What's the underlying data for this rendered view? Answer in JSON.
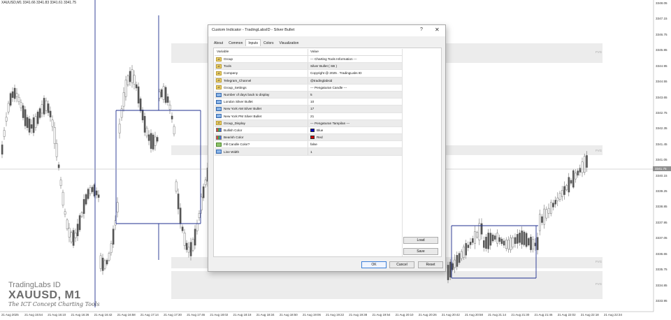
{
  "chart": {
    "header": "XAUUSD,M1  3341.66 3341.83 3341.61 3341.75",
    "price_tag": "3341.75",
    "y_axis": [
      "3348.05",
      "3347.15",
      "3346.75",
      "3345.85",
      "3344.95",
      "3344.55",
      "3343.65",
      "3342.75",
      "3342.35",
      "3341.45",
      "3341.05",
      "3340.15",
      "3339.25",
      "3338.85",
      "3337.95",
      "3337.05",
      "3336.65",
      "3335.75",
      "3334.85",
      "3333.95"
    ],
    "x_axis": [
      "21 Aug 2025",
      "21 Aug 15:54",
      "21 Aug 16:10",
      "21 Aug 16:26",
      "21 Aug 16:42",
      "21 Aug 16:58",
      "21 Aug 17:14",
      "21 Aug 17:30",
      "21 Aug 17:46",
      "21 Aug 18:02",
      "21 Aug 18:18",
      "21 Aug 18:34",
      "21 Aug 18:50",
      "21 Aug 19:06",
      "21 Aug 19:22",
      "21 Aug 19:38",
      "21 Aug 19:54",
      "21 Aug 20:10",
      "21 Aug 20:26",
      "21 Aug 20:42",
      "21 Aug 20:58",
      "21 Aug 21:14",
      "21 Aug 21:30",
      "21 Aug 21:46",
      "21 Aug 22:02",
      "21 Aug 22:18",
      "21 Aug 22:34"
    ],
    "watermark": {
      "brand": "TradingLabs ID",
      "symbol": "XAUUSD, M1",
      "tagline": "The ICT Concept Charting Tools"
    },
    "zone_tag": "FVG",
    "colors": {
      "box": "#1f2f8f",
      "bullish": "#0000c8",
      "bearish": "#d00000",
      "zone": "#ececec"
    }
  },
  "dialog": {
    "title": "Custom Indicator - TradingLabsID - Silver Bullet",
    "help_label": "?",
    "close_label": "✕",
    "tabs": [
      "About",
      "Common",
      "Inputs",
      "Colors",
      "Visualization"
    ],
    "active_tab": "Inputs",
    "columns": {
      "variable": "Variable",
      "value": "Value"
    },
    "rows": [
      {
        "icon": "ab",
        "icon_text": "ab",
        "variable": "Group",
        "value": "--- Charting Tools Information ---"
      },
      {
        "icon": "ab",
        "icon_text": "ab",
        "variable": "Tools",
        "value": "Silver Bullet ( SB )"
      },
      {
        "icon": "ab",
        "icon_text": "ab",
        "variable": "Company",
        "value": "Copyright @ 2025 . TradingLabs ID"
      },
      {
        "icon": "ab",
        "icon_text": "ab",
        "variable": "Telegram_Channel",
        "value": "@tradinglabsid"
      },
      {
        "icon": "ab",
        "icon_text": "ab",
        "variable": "Group_Settings",
        "value": "--- Pengaturan Candle ---"
      },
      {
        "icon": "n",
        "icon_text": "123",
        "variable": "Number of days back to display",
        "value": "5"
      },
      {
        "icon": "n",
        "icon_text": "123",
        "variable": "London Silver Bullet",
        "value": "10"
      },
      {
        "icon": "n",
        "icon_text": "123",
        "variable": "New York AM Silver Bullet",
        "value": "17"
      },
      {
        "icon": "n",
        "icon_text": "123",
        "variable": "New York PM Silver Bullet",
        "value": "21"
      },
      {
        "icon": "ab",
        "icon_text": "ab",
        "variable": "Group_Display",
        "value": "--- Pengaturan Tampilan ---"
      },
      {
        "icon": "clr",
        "icon_text": "",
        "variable": "Bullish Color",
        "value": "Blue",
        "swatch": "#0000c8"
      },
      {
        "icon": "clr",
        "icon_text": "",
        "variable": "Bearish Color",
        "value": "Red",
        "swatch": "#d00000"
      },
      {
        "icon": "bool",
        "icon_text": "",
        "variable": "Fill Candle Color?",
        "value": "false"
      },
      {
        "icon": "n",
        "icon_text": "123",
        "variable": "Line Width",
        "value": "1"
      }
    ],
    "buttons": {
      "load": "Load",
      "save": "Save",
      "ok": "OK",
      "cancel": "Cancel",
      "reset": "Reset"
    }
  }
}
